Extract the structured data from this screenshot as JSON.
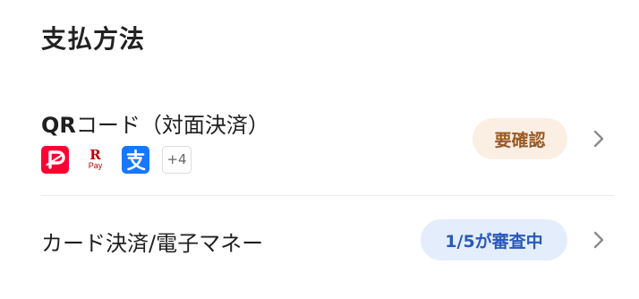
{
  "section": {
    "title": "支払方法"
  },
  "rows": [
    {
      "title_prefix": "QR",
      "title_rest": "コード（対面決済）",
      "logos": [
        {
          "icon": "paypay-icon",
          "color": "#ff0033"
        },
        {
          "icon": "rakuten-pay-icon",
          "color": "#bf0000",
          "r": "R",
          "pay": "Pay"
        },
        {
          "icon": "alipay-icon",
          "color": "#1677ff"
        }
      ],
      "more_label": "+4",
      "badge": {
        "label": "要確認",
        "bg": "#fbeee3",
        "color": "#9a5a25"
      }
    },
    {
      "title": "カード決済/電子マネー",
      "badge": {
        "label": "1/5が審査中",
        "bg": "#e4edfb",
        "color": "#2a59b8"
      }
    }
  ],
  "colors": {
    "chevron": "#8a8a8a",
    "divider": "#ececec"
  }
}
